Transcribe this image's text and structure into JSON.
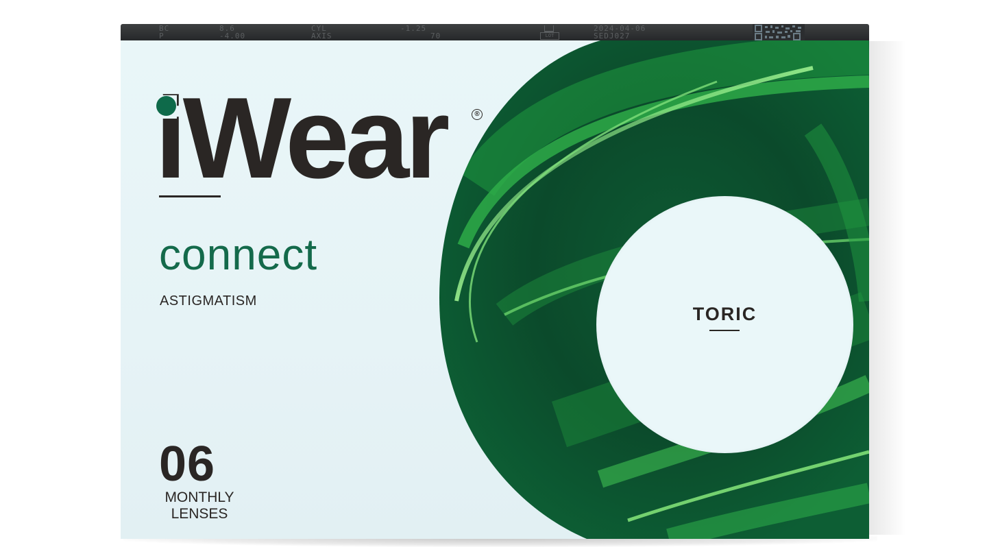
{
  "top_strip": {
    "bc_label": "BC",
    "bc_value": "8.6",
    "cyl_label": "CYL",
    "cyl_value": "-1.25",
    "p_label": "P",
    "p_value": "-4.00",
    "axis_label": "AXIS",
    "axis_value": "70",
    "expiry_date": "2024-04-06",
    "lot_label": "LOT",
    "lot_value": "SEDJ027"
  },
  "brand": {
    "name": "iWear",
    "registered_mark": "®",
    "subbrand": "connect",
    "indication": "ASTIGMATISM"
  },
  "package": {
    "count": "06",
    "unit_line1": "MONTHLY",
    "unit_line2": "LENSES"
  },
  "badge": {
    "label": "TORIC"
  },
  "colors": {
    "brand_green": "#146a4b",
    "dot_green": "#0e6a4a",
    "ink": "#2a2624",
    "background": "#e8f5f7",
    "strip": "#2b2d2f"
  },
  "icons": {
    "expiry": "hourglass-icon",
    "qr": "qr-code-icon"
  }
}
